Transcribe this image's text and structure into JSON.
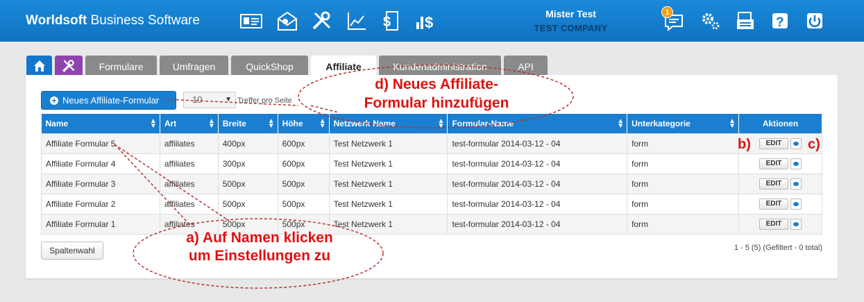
{
  "header": {
    "brand_bold": "Worldsoft",
    "brand_rest": " Business Software",
    "user_name": "Mister Test",
    "company": "TEST COMPANY",
    "notification_count": "1"
  },
  "tabs": [
    {
      "label": ""
    },
    {
      "label": ""
    },
    {
      "label": "Formulare"
    },
    {
      "label": "Umfragen"
    },
    {
      "label": "QuickShop"
    },
    {
      "label": "Affiliate"
    },
    {
      "label": "Kundenadministration"
    },
    {
      "label": "API"
    }
  ],
  "toolbar": {
    "new_button": "Neues Affiliate-Formular",
    "page_size": "10",
    "per_page_label": "Treffer pro Seite"
  },
  "table": {
    "columns": [
      "Name",
      "Art",
      "Breite",
      "Höhe",
      "Netzwerk-Name",
      "Formular-Name",
      "Unterkategorie",
      "Aktionen"
    ],
    "rows": [
      [
        "Affiliate Formular 5",
        "affiliates",
        "400px",
        "600px",
        "Test Netzwerk 1",
        "test-formular 2014-03-12 - 04",
        "form"
      ],
      [
        "Affiliate Formular 4",
        "affiliates",
        "300px",
        "600px",
        "Test Netzwerk 1",
        "test-formular 2014-03-12 - 04",
        "form"
      ],
      [
        "Affiliate Formular 3",
        "affiliates",
        "500px",
        "500px",
        "Test Netzwerk 1",
        "test-formular 2014-03-12 - 04",
        "form"
      ],
      [
        "Affiliate Formular 2",
        "affiliates",
        "500px",
        "500px",
        "Test Netzwerk 1",
        "test-formular 2014-03-12 - 04",
        "form"
      ],
      [
        "Affiliate Formular 1",
        "affiliates",
        "500px",
        "500px",
        "Test Netzwerk 1",
        "test-formular 2014-03-12 - 04",
        "form"
      ]
    ],
    "edit_label": "EDIT"
  },
  "footer": {
    "columns_button": "Spaltenwahl",
    "info": "1 - 5 (5) (Gefiltert - 0 total)"
  },
  "annotations": {
    "a_line1": "a) Auf Namen klicken",
    "a_line2": "um Einstellungen zu",
    "b": "b)",
    "c": "c)",
    "d_line1": "d) Neues Affiliate-",
    "d_line2": "Formular hinzufügen"
  },
  "colors": {
    "header": "#1483d4",
    "primary": "#1a7fd0",
    "annotation": "#e01010"
  }
}
